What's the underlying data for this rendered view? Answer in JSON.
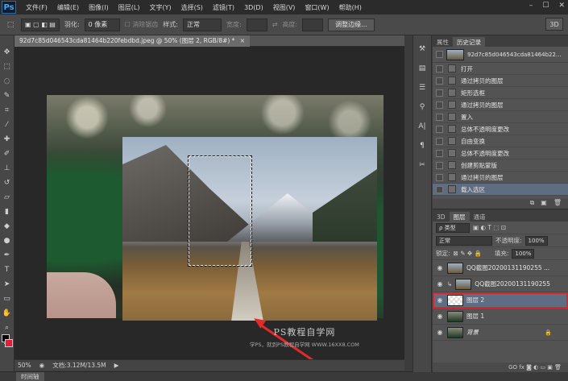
{
  "menubar": {
    "logo": "Ps",
    "items": [
      "文件(F)",
      "编辑(E)",
      "图像(I)",
      "图层(L)",
      "文字(Y)",
      "选择(S)",
      "滤镜(T)",
      "3D(D)",
      "视图(V)",
      "窗口(W)",
      "帮助(H)"
    ],
    "window_controls": [
      "–",
      "☐",
      "✕"
    ]
  },
  "options": {
    "feather_label": "羽化:",
    "feather_value": "0 像素",
    "antialias_label": "消除锯齿",
    "style_label": "样式:",
    "style_value": "正常",
    "width_label": "宽度:",
    "height_label": "高度:",
    "refine_button": "调整边缘...",
    "mode_3d": "3D"
  },
  "document": {
    "tab_title": "92d7c85d046543cda81464b220febdbd.jpeg @ 50% (图层 2, RGB/8#) *",
    "close": "×"
  },
  "watermark": {
    "title": "PS教程自学网",
    "subtitle": "学PS，就到PS教程自学网",
    "url": "WWW.16XX8.COM"
  },
  "status": {
    "zoom": "50%",
    "doc_info": "文档:3.12M/13.5M"
  },
  "timeline": {
    "label": "时间轴"
  },
  "history": {
    "tabs": [
      "属性",
      "历史记录"
    ],
    "active_tab": "历史记录",
    "snapshot_name": "92d7c85d046543cda81464b22...",
    "steps": [
      "打开",
      "通过拷贝的图层",
      "矩形选框",
      "通过拷贝的图层",
      "置入",
      "总体不透明度更改",
      "自由变换",
      "总体不透明度更改",
      "创建剪贴蒙版",
      "通过拷贝的图层",
      "载入选区"
    ],
    "active_step": "载入选区",
    "footer_icons": [
      "⧉",
      "▣",
      "🗑"
    ]
  },
  "layers": {
    "tabs": [
      "3D",
      "图层",
      "通道"
    ],
    "active_tab": "图层",
    "kind_label": "ρ 类型",
    "filter_icons": "▣ ◐ T ⬚ ⊡",
    "blend_mode": "正常",
    "opacity_label": "不透明度:",
    "opacity_value": "100%",
    "lock_label": "锁定:",
    "lock_icons": "⊠ ✎ ✥ 🔒",
    "fill_label": "填充:",
    "fill_value": "100%",
    "items": [
      {
        "name": "QQ截图20200131190255 ...",
        "visible": true,
        "selected": false
      },
      {
        "name": "QQ截图20200131190255",
        "visible": true,
        "selected": false
      },
      {
        "name": "图层 2",
        "visible": true,
        "selected": true
      },
      {
        "name": "图层 1",
        "visible": true,
        "selected": false
      },
      {
        "name": "背景",
        "visible": true,
        "selected": false
      }
    ],
    "footer_icons": "GO fx ◙ ◐ ▭ ▣ 🗑"
  },
  "colors": {
    "foreground": "#000000",
    "background": "#e0203a",
    "selection_highlight": "#5e6d82",
    "annotation_red": "#d8262c"
  }
}
